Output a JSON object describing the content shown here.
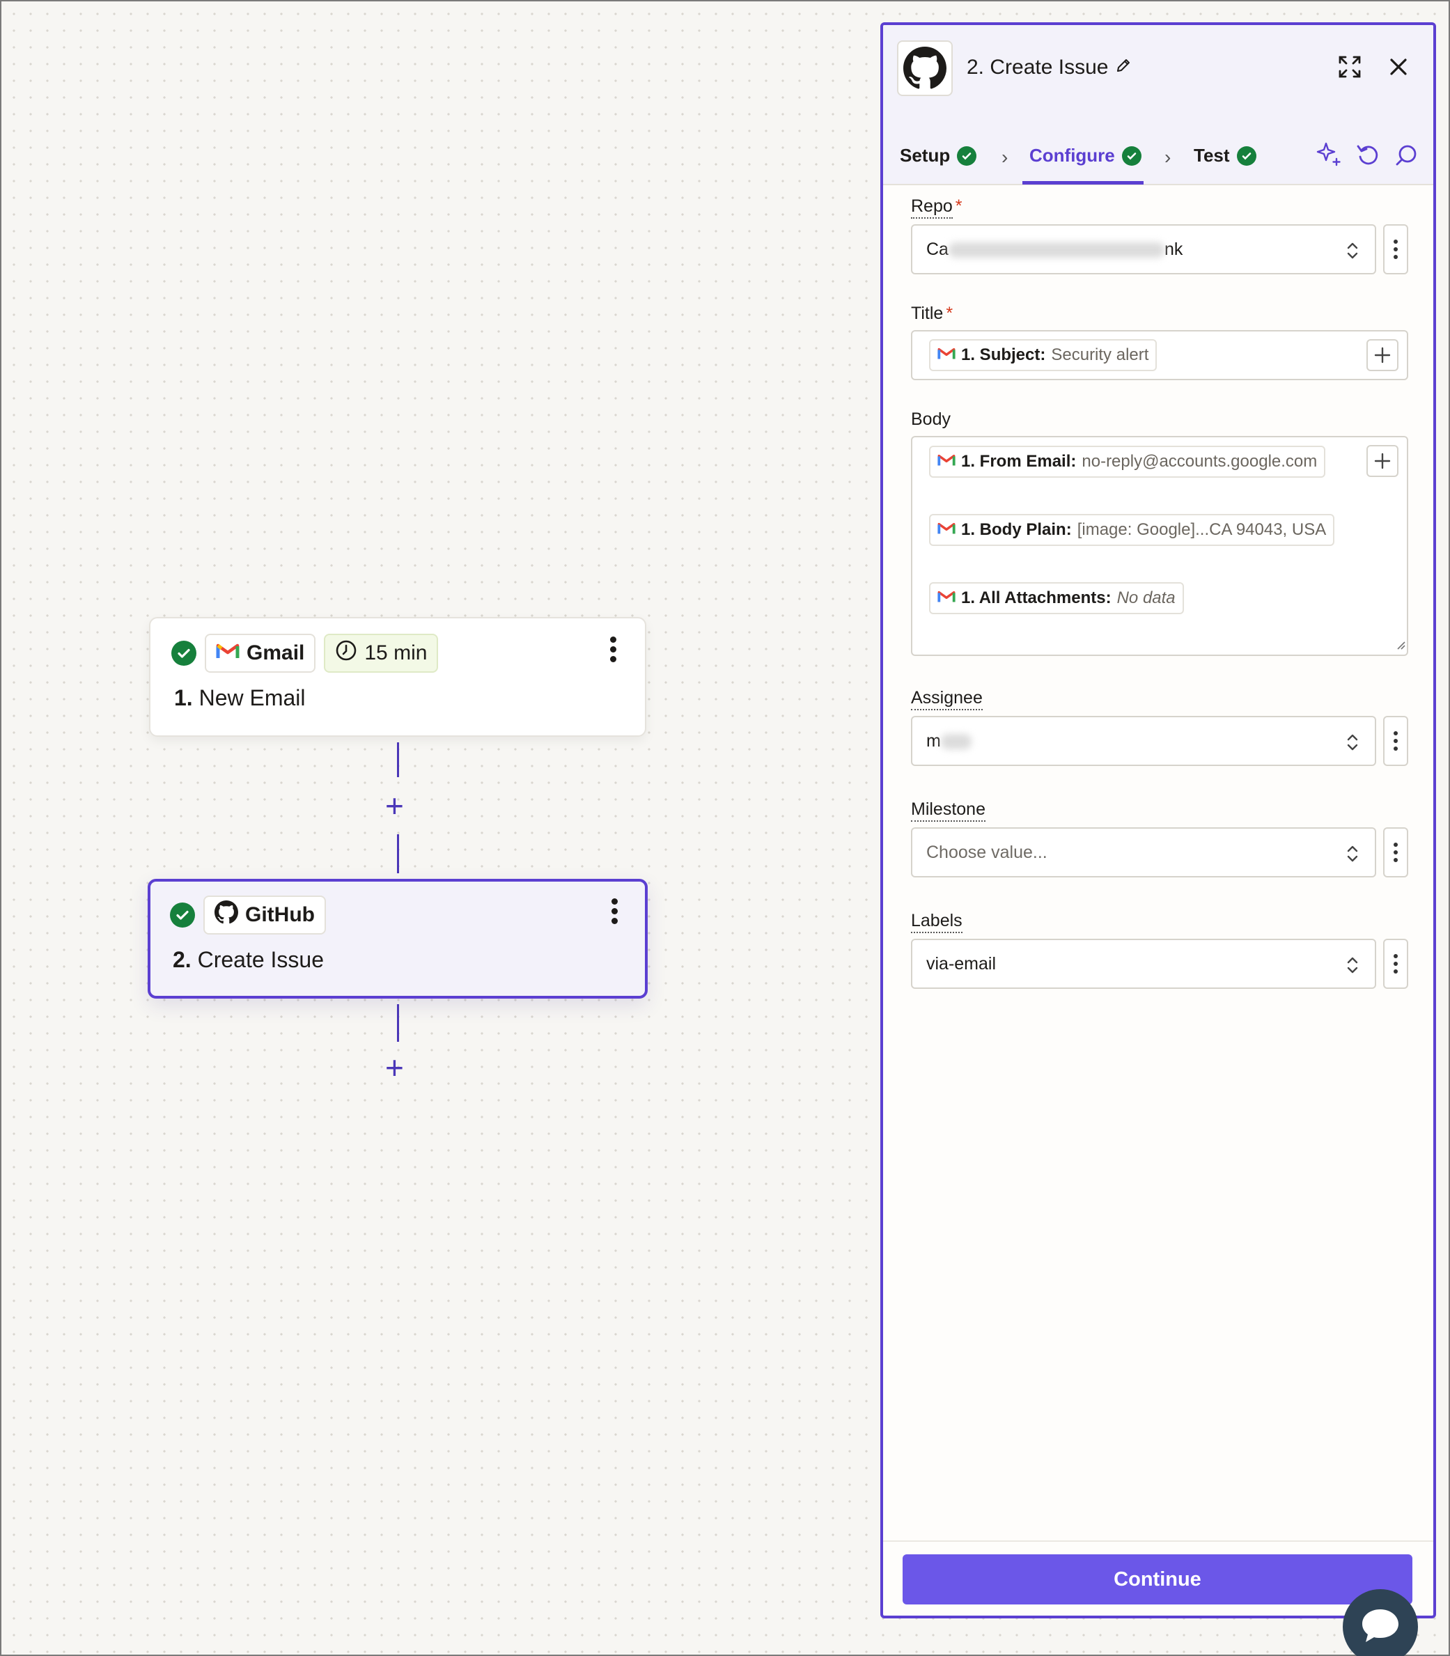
{
  "canvas": {
    "step1": {
      "app": "Gmail",
      "interval": "15 min",
      "number": "1.",
      "name": "New Email"
    },
    "step2": {
      "app": "GitHub",
      "number": "2.",
      "name": "Create Issue"
    }
  },
  "panel": {
    "title": "2. Create Issue",
    "tabs": [
      {
        "label": "Setup"
      },
      {
        "label": "Configure"
      },
      {
        "label": "Test"
      }
    ],
    "fields": {
      "repo": {
        "label": "Repo",
        "value_start": "Ca",
        "value_end": "nk"
      },
      "title": {
        "label": "Title",
        "pill_key": "1. Subject:",
        "pill_value": "Security alert"
      },
      "body": {
        "label": "Body",
        "pills": [
          {
            "key": "1. From Email:",
            "value": "no-reply@accounts.google.com"
          },
          {
            "key": "1. Body Plain:",
            "value": "[image: Google]...CA 94043, USA"
          },
          {
            "key": "1. All Attachments:",
            "value": "No data"
          }
        ]
      },
      "assignee": {
        "label": "Assignee",
        "value": "m"
      },
      "milestone": {
        "label": "Milestone",
        "placeholder": "Choose value..."
      },
      "labels": {
        "label": "Labels",
        "value": "via-email"
      }
    },
    "continue_label": "Continue"
  },
  "colors": {
    "accent": "#5b3fd1",
    "button": "#6b57e8",
    "success": "#16803c",
    "required": "#d5381a"
  },
  "icons": [
    "github-icon",
    "gmail-icon",
    "clock-icon",
    "pencil-icon",
    "expand-icon",
    "close-icon",
    "sparkle-icon",
    "undo-icon",
    "comment-icon",
    "chat-icon"
  ]
}
